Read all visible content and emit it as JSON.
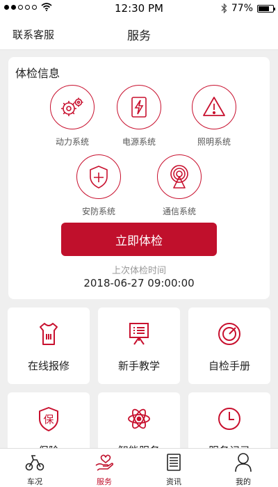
{
  "status_bar": {
    "time": "12:30 PM",
    "battery": "77%",
    "battery_level": 0.77,
    "signal_dots_filled": 2,
    "signal_dots_total": 5
  },
  "header": {
    "left_link": "联系客服",
    "title": "服务"
  },
  "checkup": {
    "title": "体检信息",
    "systems": [
      {
        "label": "动力系统",
        "icon": "gears-icon"
      },
      {
        "label": "电源系统",
        "icon": "power-bolt-icon"
      },
      {
        "label": "照明系统",
        "icon": "warning-triangle-icon"
      },
      {
        "label": "安防系统",
        "icon": "shield-plus-icon"
      },
      {
        "label": "通信系统",
        "icon": "signal-tower-icon"
      }
    ],
    "button_label": "立即体检",
    "last_label": "上次体检时间",
    "last_time": "2018-06-27 09:00:00"
  },
  "tiles": [
    {
      "label": "在线报修",
      "icon": "repair-shirt-icon"
    },
    {
      "label": "新手教学",
      "icon": "presentation-board-icon"
    },
    {
      "label": "自检手册",
      "icon": "gauge-icon"
    },
    {
      "label": "保险",
      "icon": "insurance-shield-icon"
    },
    {
      "label": "智能服务",
      "icon": "atom-icon"
    },
    {
      "label": "服务记录",
      "icon": "clock-icon"
    }
  ],
  "tab_bar": {
    "items": [
      {
        "label": "车况",
        "icon": "scooter-icon"
      },
      {
        "label": "服务",
        "icon": "hand-heart-icon"
      },
      {
        "label": "资讯",
        "icon": "news-icon"
      },
      {
        "label": "我的",
        "icon": "person-icon"
      }
    ],
    "active_index": 1
  },
  "colors": {
    "accent": "#c0102c",
    "background": "#efefef",
    "card": "#ffffff"
  }
}
